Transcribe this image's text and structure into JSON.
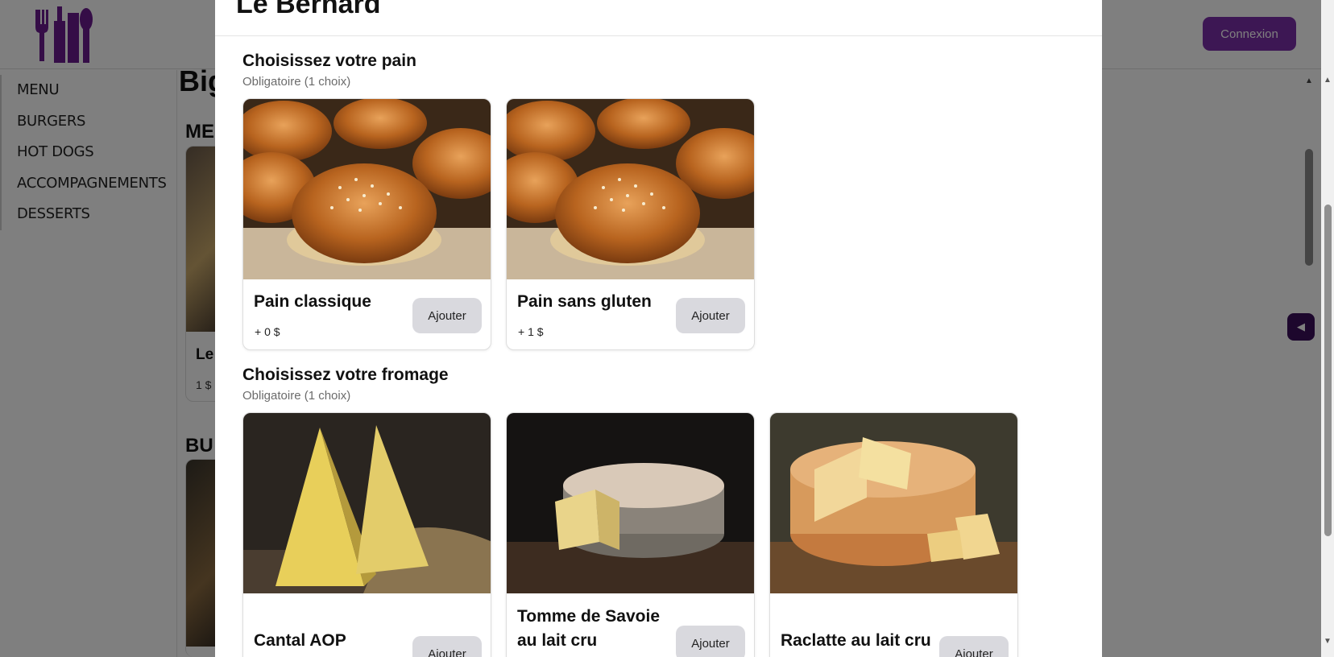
{
  "app": {
    "login_label": "Connexion",
    "brand_color": "#7b2fa8",
    "logo_icon": "utensils-icon"
  },
  "sidebar": {
    "items": [
      {
        "label": "MENU"
      },
      {
        "label": "BURGERS"
      },
      {
        "label": "HOT DOGS"
      },
      {
        "label": "ACCOMPAGNEMENTS"
      },
      {
        "label": "DESSERTS"
      }
    ]
  },
  "background": {
    "page_title_partial": "Big",
    "section1_partial": "ME",
    "section2_partial": "BU",
    "card_name_partial": "Le",
    "card_price_partial": "1 $"
  },
  "modal": {
    "title": "Le Bernard",
    "sections": [
      {
        "title": "Choisissez votre pain",
        "subtitle": "Obligatoire (1 choix)",
        "options": [
          {
            "name": "Pain classique",
            "price": "+ 0 $",
            "button": "Ajouter"
          },
          {
            "name": "Pain sans gluten",
            "price": "+ 1 $",
            "button": "Ajouter"
          }
        ]
      },
      {
        "title": "Choisissez votre fromage",
        "subtitle": "Obligatoire (1 choix)",
        "options": [
          {
            "name": "Cantal AOP",
            "button": "Ajouter"
          },
          {
            "name": "Tomme de Savoie au lait cru",
            "button": "Ajouter"
          },
          {
            "name": "Raclatte au lait cru",
            "button": "Ajouter"
          }
        ]
      }
    ]
  }
}
